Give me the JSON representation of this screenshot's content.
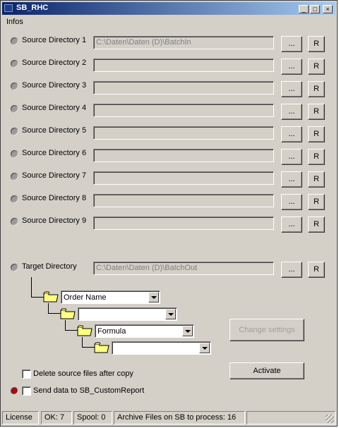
{
  "window": {
    "title": "SB_RHC"
  },
  "title_buttons": {
    "minimize": "_",
    "maximize": "□",
    "close": "×"
  },
  "menu": {
    "infos": "Infos"
  },
  "source_dirs": [
    {
      "label": "Source Directory 1",
      "value": "C:\\Daten\\Daten (D)\\BatchIn",
      "browse": "...",
      "reset": "R"
    },
    {
      "label": "Source Directory 2",
      "value": "",
      "browse": "...",
      "reset": "R"
    },
    {
      "label": "Source Directory 3",
      "value": "",
      "browse": "...",
      "reset": "R"
    },
    {
      "label": "Source Directory 4",
      "value": "",
      "browse": "...",
      "reset": "R"
    },
    {
      "label": "Source Directory 5",
      "value": "",
      "browse": "...",
      "reset": "R"
    },
    {
      "label": "Source Directory 6",
      "value": "",
      "browse": "...",
      "reset": "R"
    },
    {
      "label": "Source Directory 7",
      "value": "",
      "browse": "...",
      "reset": "R"
    },
    {
      "label": "Source Directory 8",
      "value": "",
      "browse": "...",
      "reset": "R"
    },
    {
      "label": "Source Directory 9",
      "value": "",
      "browse": "...",
      "reset": "R"
    }
  ],
  "target": {
    "label": "Target Directory",
    "value": "C:\\Daten\\Daten (D)\\BatchOut",
    "browse": "...",
    "reset": "R"
  },
  "subfolders": [
    {
      "selected": "Order Name"
    },
    {
      "selected": ""
    },
    {
      "selected": "Formula"
    },
    {
      "selected": ""
    }
  ],
  "buttons": {
    "change_settings": "Change settings",
    "activate": "Activate"
  },
  "options": {
    "delete_source": "Delete source files after copy",
    "send_data": "Send data to SB_CustomReport"
  },
  "status": {
    "license": "License",
    "ok": "OK: 7",
    "spool": "Spool: 0",
    "archive": "Archive Files on SB to process: 16"
  },
  "colors": {
    "titlebar_start": "#0a246a",
    "titlebar_end": "#a6caf0",
    "face": "#d4d0c8",
    "folder": "#ffff80",
    "active_led": "#c00000"
  }
}
